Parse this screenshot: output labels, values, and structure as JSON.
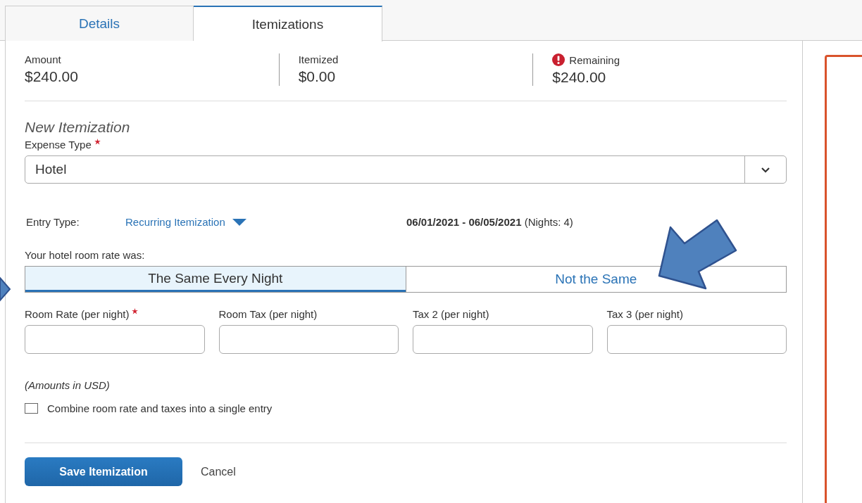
{
  "tabs": [
    {
      "label": "Details",
      "selected": false
    },
    {
      "label": "Itemizations",
      "selected": true
    }
  ],
  "summary": [
    {
      "label": "Amount",
      "value": "$240.00",
      "alert": false
    },
    {
      "label": "Itemized",
      "value": "$0.00",
      "alert": false
    },
    {
      "label": "Remaining",
      "value": "$240.00",
      "alert": true
    }
  ],
  "form": {
    "heading": "New Itemization",
    "expense_type": {
      "label": "Expense Type",
      "required": true,
      "value": "Hotel"
    },
    "entry_type": {
      "label": "Entry Type:",
      "value": "Recurring Itemization",
      "dates": "**06/01/2021 - 06/05/2021** (Nights: 4)"
    },
    "rate_question": "Your hotel room rate was:",
    "rate_options": [
      {
        "label": "The Same Every Night",
        "selected": true
      },
      {
        "label": "Not the Same",
        "selected": false
      }
    ],
    "fields": [
      {
        "label": "Room Rate (per night)",
        "required": true
      },
      {
        "label": "Room Tax (per night)",
        "required": false
      },
      {
        "label": "Tax 2 (per night)",
        "required": false
      },
      {
        "label": "Tax 3 (per night)",
        "required": false
      }
    ],
    "currency_note": "(Amounts in USD)",
    "combine": {
      "label": "Combine room rate and taxes into a single entry",
      "checked": false
    }
  },
  "buttons": {
    "save": "Save Itemization",
    "cancel": "Cancel"
  }
}
